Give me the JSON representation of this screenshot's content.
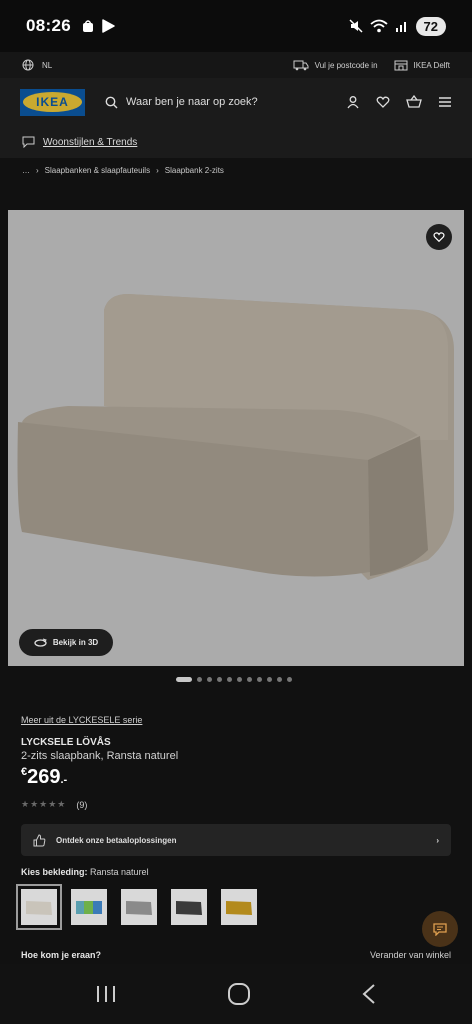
{
  "status_bar": {
    "time": "08:26",
    "battery": "72"
  },
  "top_bar": {
    "language": "NL",
    "postcode_label": "Vul je postcode in",
    "store_label": "IKEA Delft"
  },
  "header": {
    "logo_text": "IKEA",
    "search_placeholder": "Waar ben je naar op zoek?"
  },
  "trends_link": "Woonstijlen & Trends",
  "breadcrumb": {
    "ellipsis": "…",
    "level1": "Slaapbanken & slaapfauteuils",
    "level2": "Slaapbank 2-zits"
  },
  "gallery": {
    "view_3d_label": "Bekijk in 3D",
    "image_count": 11,
    "active_index": 0
  },
  "product": {
    "series_link": "Meer uit de LYCKESELE serie",
    "name": "LYCKSELE LÖVÅS",
    "description": "2-zits slaapbank, Ransta naturel",
    "currency": "€",
    "price": "269",
    "price_decimals": ".-",
    "rating": 4,
    "rating_max": 5,
    "review_count": "(9)"
  },
  "payment_banner": "Ontdek onze betaaloplossingen",
  "cover": {
    "label": "Kies bekleding:",
    "selected": "Ransta naturel",
    "swatches": [
      {
        "name": "Ransta naturel",
        "color": "#c9c4ba"
      },
      {
        "name": "Multicolor",
        "color": "#5a9fb0"
      },
      {
        "name": "Grijs",
        "color": "#8a8a8a"
      },
      {
        "name": "Zwart",
        "color": "#3a3a3a"
      },
      {
        "name": "Geel",
        "color": "#b38a1c"
      }
    ]
  },
  "delivery": {
    "question": "Hoe kom je eraan?",
    "change_store": "Verander van winkel"
  },
  "colors": {
    "brand_blue": "#0a4d8f",
    "brand_yellow": "#c9a930",
    "image_bg": "#ababab"
  }
}
